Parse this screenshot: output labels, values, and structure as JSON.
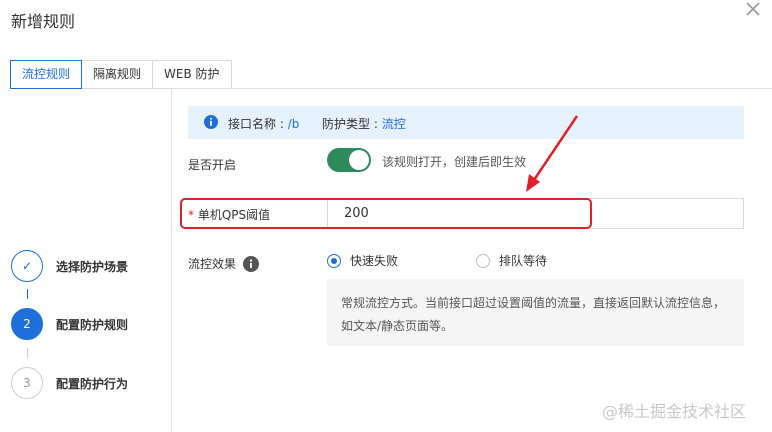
{
  "dialog": {
    "title": "新增规则"
  },
  "tabs": [
    {
      "label": "流控规则",
      "active": true
    },
    {
      "label": "隔离规则",
      "active": false
    },
    {
      "label": "WEB 防护",
      "active": false
    }
  ],
  "info": {
    "name_label": "接口名称 :",
    "name_value": "/b",
    "type_label": "防护类型 :",
    "type_value": "流控"
  },
  "form": {
    "enabled_label": "是否开启",
    "enabled": true,
    "enabled_desc": "该规则打开，创建后即生效",
    "qps_required_mark": "*",
    "qps_label": "单机QPS阈值",
    "qps_value": "200",
    "effect_label": "流控效果",
    "effect_options": [
      {
        "label": "快速失败",
        "selected": true
      },
      {
        "label": "排队等待",
        "selected": false
      }
    ],
    "effect_desc_line1": "常规流控方式。当前接口超过设置阈值的流量，直接返回默认流控信息，",
    "effect_desc_line2": "如文本/静态页面等。"
  },
  "steps": [
    {
      "number": "✓",
      "label": "选择防护场景",
      "state": "done"
    },
    {
      "number": "2",
      "label": "配置防护规则",
      "state": "current"
    },
    {
      "number": "3",
      "label": "配置防护行为",
      "state": "pending"
    }
  ],
  "watermark": "@稀土掘金技术社区",
  "colors": {
    "accent": "#1e6fd9",
    "toggle_on": "#2d8a5b",
    "annotation": "#e0202a",
    "info_bg": "#e5f1fb"
  }
}
